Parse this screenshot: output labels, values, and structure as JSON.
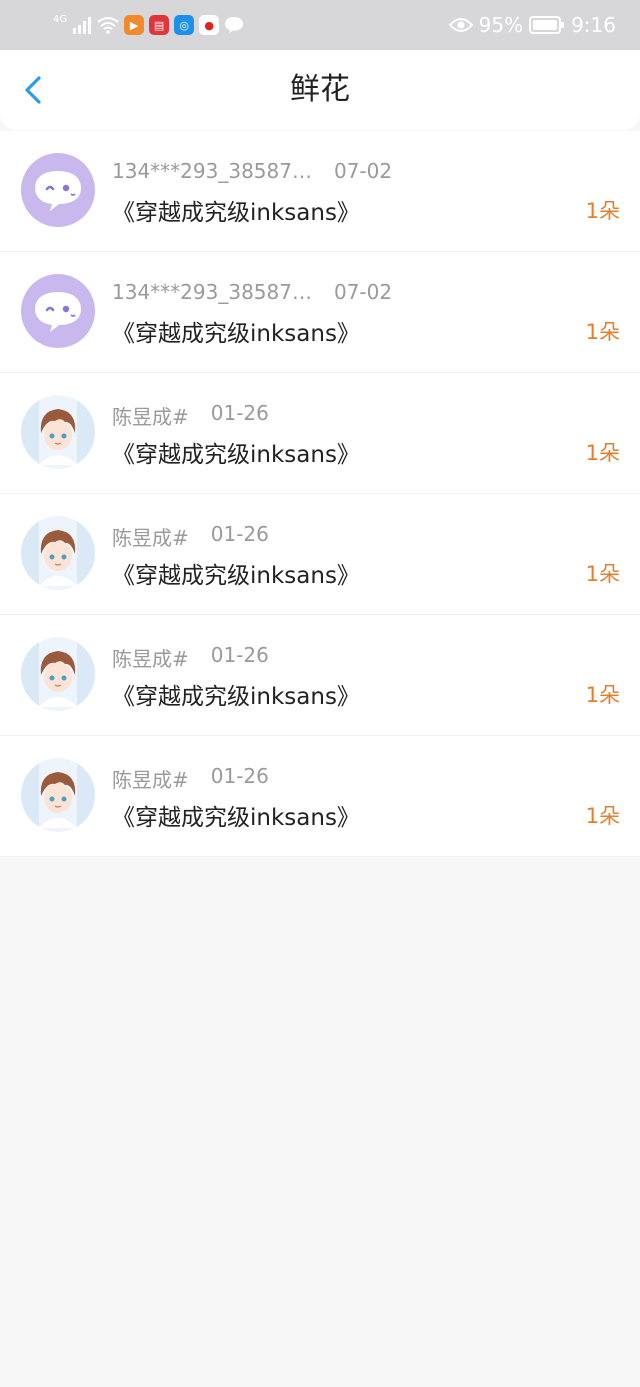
{
  "status_bar": {
    "network": "4G",
    "battery": "95%",
    "time": "9:16"
  },
  "header": {
    "title": "鲜花"
  },
  "items": [
    {
      "name": "134***293_38587…",
      "date": "07-02",
      "book": "《穿越成究级inksans》",
      "count": "1朵",
      "avatar": "chat-bubble"
    },
    {
      "name": "134***293_38587…",
      "date": "07-02",
      "book": "《穿越成究级inksans》",
      "count": "1朵",
      "avatar": "chat-bubble"
    },
    {
      "name": "陈昱成#",
      "date": "01-26",
      "book": "《穿越成究级inksans》",
      "count": "1朵",
      "avatar": "anime-boy"
    },
    {
      "name": "陈昱成#",
      "date": "01-26",
      "book": "《穿越成究级inksans》",
      "count": "1朵",
      "avatar": "anime-boy"
    },
    {
      "name": "陈昱成#",
      "date": "01-26",
      "book": "《穿越成究级inksans》",
      "count": "1朵",
      "avatar": "anime-boy"
    },
    {
      "name": "陈昱成#",
      "date": "01-26",
      "book": "《穿越成究级inksans》",
      "count": "1朵",
      "avatar": "anime-boy"
    }
  ],
  "colors": {
    "accent_back": "#2a9be6",
    "count_color": "#e57e2b",
    "avatar_purple": "#c9b8ee"
  }
}
